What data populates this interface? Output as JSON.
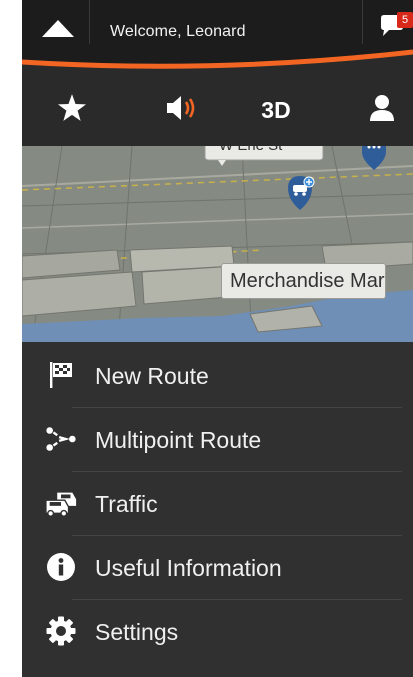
{
  "header": {
    "welcome_text": "Welcome, Leonard",
    "notification_count": "5",
    "accent_color": "#f26522"
  },
  "toolbar": {
    "favorites_icon": "star-icon",
    "sound_icon": "speaker-icon",
    "view_mode": "3D",
    "profile_icon": "user-icon"
  },
  "map": {
    "street_label": "W Erie St",
    "place_label": "Merchandise Mar"
  },
  "menu": {
    "items": [
      {
        "label": "New Route",
        "icon": "checkered-flag-icon"
      },
      {
        "label": "Multipoint Route",
        "icon": "multipoint-icon"
      },
      {
        "label": "Traffic",
        "icon": "traffic-cars-icon"
      },
      {
        "label": "Useful Information",
        "icon": "info-icon"
      },
      {
        "label": "Settings",
        "icon": "gear-icon"
      }
    ]
  }
}
